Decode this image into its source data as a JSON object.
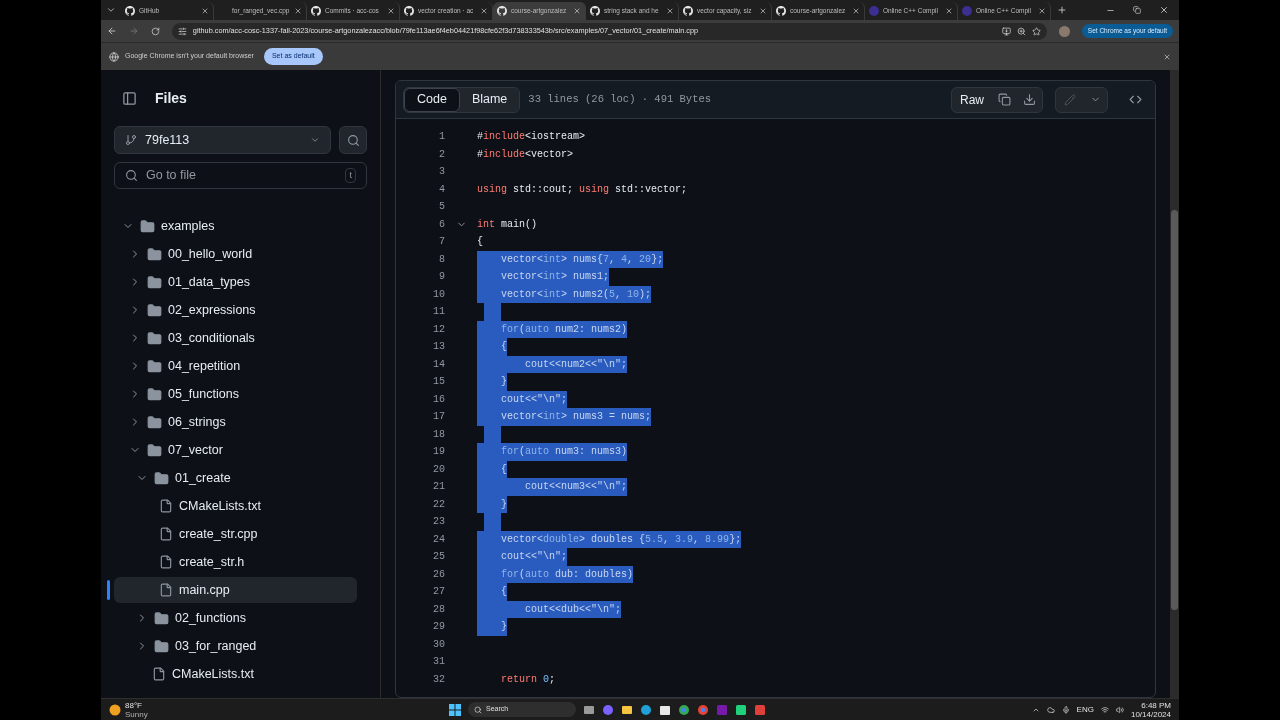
{
  "browser": {
    "tabs": [
      {
        "title": "GitHub",
        "kind": "github",
        "selected": false
      },
      {
        "title": "for_ranged_vec.cpp",
        "kind": "plain",
        "selected": false
      },
      {
        "title": "Commits · acc-cos",
        "kind": "github",
        "selected": false
      },
      {
        "title": "vector creation · ac",
        "kind": "github",
        "selected": false
      },
      {
        "title": "course-artgonzalez",
        "kind": "github",
        "selected": true
      },
      {
        "title": "string stack and he",
        "kind": "github",
        "selected": false
      },
      {
        "title": "vector capacity, siz",
        "kind": "github",
        "selected": false
      },
      {
        "title": "course-artgonzalez",
        "kind": "github",
        "selected": false
      },
      {
        "title": "Online C++ Compil",
        "kind": "compiler",
        "selected": false
      },
      {
        "title": "Online C++ Compil",
        "kind": "compiler",
        "selected": false
      }
    ],
    "address": "github.com/acc-cosc-1337-fall-2023/course-artgonzalezacc/blob/79fe113ae6f4eb04421f98cfe62f3d738333543b/src/examples/07_vector/01_create/main.cpp",
    "default_prompt": "Set Chrome as your default",
    "infobar": {
      "text": "Google Chrome isn't your default browser",
      "button": "Set as default"
    }
  },
  "sidebar": {
    "title": "Files",
    "branch": "79fe113",
    "search": {
      "placeholder": "Go to file",
      "shortcut": "t"
    },
    "tree": [
      {
        "name": "examples",
        "kind": "folder",
        "expanded": true,
        "selected": false,
        "children": [
          {
            "name": "00_hello_world",
            "kind": "folder",
            "expanded": false,
            "selected": false
          },
          {
            "name": "01_data_types",
            "kind": "folder",
            "expanded": false,
            "selected": false
          },
          {
            "name": "02_expressions",
            "kind": "folder",
            "expanded": false,
            "selected": false
          },
          {
            "name": "03_conditionals",
            "kind": "folder",
            "expanded": false,
            "selected": false
          },
          {
            "name": "04_repetition",
            "kind": "folder",
            "expanded": false,
            "selected": false
          },
          {
            "name": "05_functions",
            "kind": "folder",
            "expanded": false,
            "selected": false
          },
          {
            "name": "06_strings",
            "kind": "folder",
            "expanded": false,
            "selected": false
          },
          {
            "name": "07_vector",
            "kind": "folder",
            "expanded": true,
            "selected": false,
            "children": [
              {
                "name": "01_create",
                "kind": "folder",
                "expanded": true,
                "selected": false,
                "children": [
                  {
                    "name": "CMakeLists.txt",
                    "kind": "file",
                    "selected": false
                  },
                  {
                    "name": "create_str.cpp",
                    "kind": "file",
                    "selected": false
                  },
                  {
                    "name": "create_str.h",
                    "kind": "file",
                    "selected": false
                  },
                  {
                    "name": "main.cpp",
                    "kind": "file",
                    "selected": true
                  }
                ]
              },
              {
                "name": "02_functions",
                "kind": "folder",
                "expanded": false,
                "selected": false
              },
              {
                "name": "03_for_ranged",
                "kind": "folder",
                "expanded": false,
                "selected": false
              },
              {
                "name": "CMakeLists.txt",
                "kind": "file",
                "selected": false
              }
            ]
          }
        ]
      }
    ]
  },
  "file": {
    "views": [
      {
        "label": "Code",
        "selected": true
      },
      {
        "label": "Blame",
        "selected": false
      }
    ],
    "info": "33 lines (26 loc) · 491 Bytes",
    "raw_button": "Raw",
    "lines": [
      {
        "number": "1",
        "selected": false,
        "tokens": [
          {
            "kind": "pl",
            "text": "#"
          },
          {
            "kind": "kw",
            "text": "include"
          },
          {
            "kind": "pl",
            "text": "<iostream>"
          }
        ]
      },
      {
        "number": "2",
        "selected": false,
        "tokens": [
          {
            "kind": "pl",
            "text": "#"
          },
          {
            "kind": "kw",
            "text": "include"
          },
          {
            "kind": "pl",
            "text": "<vector>"
          }
        ]
      },
      {
        "number": "3",
        "selected": false
      },
      {
        "number": "4",
        "selected": false,
        "tokens": [
          {
            "kind": "kw",
            "text": "using"
          },
          {
            "kind": "pl",
            "text": " std::cout; "
          },
          {
            "kind": "kw",
            "text": "using"
          },
          {
            "kind": "pl",
            "text": " std::vector;"
          }
        ]
      },
      {
        "number": "5",
        "selected": false
      },
      {
        "number": "6",
        "selected": false,
        "expanded": true,
        "tokens": [
          {
            "kind": "kw",
            "text": "int"
          },
          {
            "kind": "pl",
            "text": " main()"
          }
        ]
      },
      {
        "number": "7",
        "selected": false,
        "tokens": [
          {
            "kind": "pl",
            "text": "{"
          }
        ]
      },
      {
        "number": "8",
        "selected": true,
        "tokens": [
          {
            "kind": "pl",
            "text": "    vector<"
          },
          {
            "kind": "kw",
            "text": "int"
          },
          {
            "kind": "pl",
            "text": "> nums{"
          },
          {
            "kind": "num",
            "text": "7"
          },
          {
            "kind": "pl",
            "text": ", "
          },
          {
            "kind": "num",
            "text": "4"
          },
          {
            "kind": "pl",
            "text": ", "
          },
          {
            "kind": "num",
            "text": "20"
          },
          {
            "kind": "pl",
            "text": "};"
          }
        ]
      },
      {
        "number": "9",
        "selected": true,
        "tokens": [
          {
            "kind": "pl",
            "text": "    vector<"
          },
          {
            "kind": "kw",
            "text": "int"
          },
          {
            "kind": "pl",
            "text": "> nums1;"
          }
        ]
      },
      {
        "number": "10",
        "selected": true,
        "tokens": [
          {
            "kind": "pl",
            "text": "    vector<"
          },
          {
            "kind": "kw",
            "text": "int"
          },
          {
            "kind": "pl",
            "text": "> nums2("
          },
          {
            "kind": "num",
            "text": "5"
          },
          {
            "kind": "pl",
            "text": ", "
          },
          {
            "kind": "num",
            "text": "10"
          },
          {
            "kind": "pl",
            "text": ");"
          }
        ]
      },
      {
        "number": "11",
        "selected": true
      },
      {
        "number": "12",
        "selected": true,
        "tokens": [
          {
            "kind": "kw",
            "text": "    for"
          },
          {
            "kind": "pl",
            "text": "("
          },
          {
            "kind": "kw",
            "text": "auto"
          },
          {
            "kind": "pl",
            "text": " num2: nums2)"
          }
        ]
      },
      {
        "number": "13",
        "selected": true,
        "tokens": [
          {
            "kind": "pl",
            "text": "    {"
          }
        ]
      },
      {
        "number": "14",
        "selected": true,
        "tokens": [
          {
            "kind": "pl",
            "text": "        cout<<num2<<"
          },
          {
            "kind": "str",
            "text": "\"\\n\""
          },
          {
            "kind": "pl",
            "text": ";"
          }
        ]
      },
      {
        "number": "15",
        "selected": true,
        "tokens": [
          {
            "kind": "pl",
            "text": "    }"
          }
        ]
      },
      {
        "number": "16",
        "selected": true,
        "tokens": [
          {
            "kind": "pl",
            "text": "    cout<<"
          },
          {
            "kind": "str",
            "text": "\"\\n\""
          },
          {
            "kind": "pl",
            "text": ";"
          }
        ]
      },
      {
        "number": "17",
        "selected": true,
        "tokens": [
          {
            "kind": "pl",
            "text": "    vector<"
          },
          {
            "kind": "kw",
            "text": "int"
          },
          {
            "kind": "pl",
            "text": "> nums3 = nums;"
          }
        ]
      },
      {
        "number": "18",
        "selected": true
      },
      {
        "number": "19",
        "selected": true,
        "tokens": [
          {
            "kind": "kw",
            "text": "    for"
          },
          {
            "kind": "pl",
            "text": "("
          },
          {
            "kind": "kw",
            "text": "auto"
          },
          {
            "kind": "pl",
            "text": " num3: nums3)"
          }
        ]
      },
      {
        "number": "20",
        "selected": true,
        "tokens": [
          {
            "kind": "pl",
            "text": "    {"
          }
        ]
      },
      {
        "number": "21",
        "selected": true,
        "tokens": [
          {
            "kind": "pl",
            "text": "        cout<<num3<<"
          },
          {
            "kind": "str",
            "text": "\"\\n\""
          },
          {
            "kind": "pl",
            "text": ";"
          }
        ]
      },
      {
        "number": "22",
        "selected": true,
        "tokens": [
          {
            "kind": "pl",
            "text": "    }"
          }
        ]
      },
      {
        "number": "23",
        "selected": true
      },
      {
        "number": "24",
        "selected": true,
        "tokens": [
          {
            "kind": "pl",
            "text": "    vector<"
          },
          {
            "kind": "kw",
            "text": "double"
          },
          {
            "kind": "pl",
            "text": "> doubles {"
          },
          {
            "kind": "num",
            "text": "5.5"
          },
          {
            "kind": "pl",
            "text": ", "
          },
          {
            "kind": "num",
            "text": "3.9"
          },
          {
            "kind": "pl",
            "text": ", "
          },
          {
            "kind": "num",
            "text": "8.99"
          },
          {
            "kind": "pl",
            "text": "};"
          }
        ]
      },
      {
        "number": "25",
        "selected": true,
        "tokens": [
          {
            "kind": "pl",
            "text": "    cout<<"
          },
          {
            "kind": "str",
            "text": "\"\\n\""
          },
          {
            "kind": "pl",
            "text": ";"
          }
        ]
      },
      {
        "number": "26",
        "selected": true,
        "tokens": [
          {
            "kind": "kw",
            "text": "    for"
          },
          {
            "kind": "pl",
            "text": "("
          },
          {
            "kind": "kw",
            "text": "auto"
          },
          {
            "kind": "pl",
            "text": " dub: doubles)"
          }
        ]
      },
      {
        "number": "27",
        "selected": true,
        "tokens": [
          {
            "kind": "pl",
            "text": "    {"
          }
        ]
      },
      {
        "number": "28",
        "selected": true,
        "tokens": [
          {
            "kind": "pl",
            "text": "        cout<<dub<<"
          },
          {
            "kind": "str",
            "text": "\"\\n\""
          },
          {
            "kind": "pl",
            "text": ";"
          }
        ]
      },
      {
        "number": "29",
        "selected": true,
        "tokens": [
          {
            "kind": "pl",
            "text": "    }"
          }
        ]
      },
      {
        "number": "30",
        "selected": false
      },
      {
        "number": "31",
        "selected": false
      },
      {
        "number": "32",
        "selected": false,
        "tokens": [
          {
            "kind": "kw",
            "text": "    return"
          },
          {
            "kind": "num",
            "text": " 0"
          },
          {
            "kind": "pl",
            "text": ";"
          }
        ]
      }
    ]
  },
  "taskbar": {
    "weather": {
      "temp": "88°F",
      "condition": "Sunny"
    },
    "search": "Search",
    "language": "ENG",
    "time": "6:48 PM",
    "date": "10/14/2024"
  }
}
